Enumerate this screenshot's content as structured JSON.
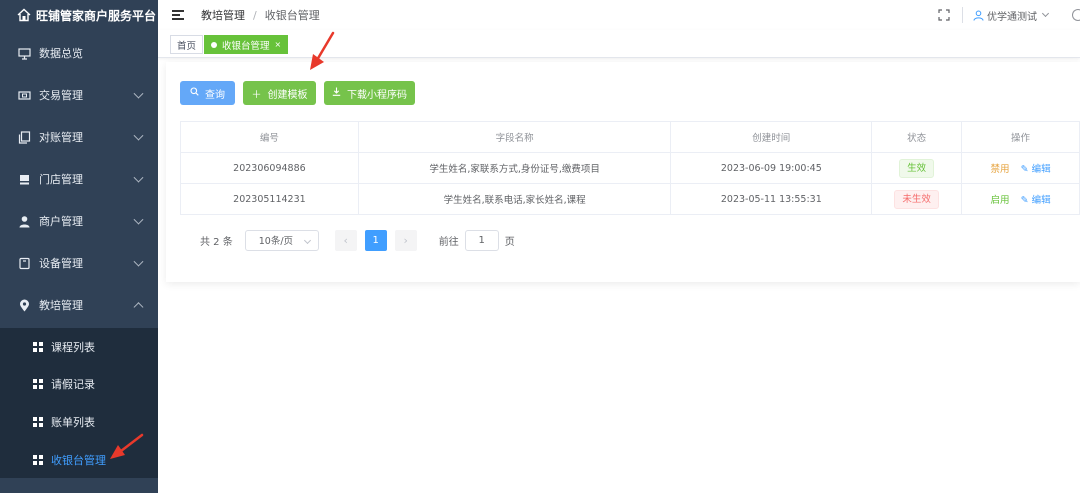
{
  "brand": {
    "title": "旺铺管家商户服务平台"
  },
  "sidebar": {
    "items": [
      {
        "label": "数据总览",
        "icon": "monitor-icon",
        "expandable": false
      },
      {
        "label": "交易管理",
        "icon": "money-icon",
        "expandable": true
      },
      {
        "label": "对账管理",
        "icon": "copy-icon",
        "expandable": true
      },
      {
        "label": "门店管理",
        "icon": "shop-icon",
        "expandable": true
      },
      {
        "label": "商户管理",
        "icon": "user-icon",
        "expandable": true
      },
      {
        "label": "设备管理",
        "icon": "device-icon",
        "expandable": true
      },
      {
        "label": "教培管理",
        "icon": "location-icon",
        "expandable": true,
        "expanded": true
      }
    ],
    "subitems": [
      {
        "label": "课程列表",
        "active": false
      },
      {
        "label": "请假记录",
        "active": false
      },
      {
        "label": "账单列表",
        "active": false
      },
      {
        "label": "收银台管理",
        "active": true
      }
    ]
  },
  "header": {
    "breadcrumb": [
      "教培管理",
      "收银台管理"
    ],
    "user_name": "优学通测试"
  },
  "tags": [
    {
      "label": "首页",
      "active": false
    },
    {
      "label": "收银台管理",
      "active": true,
      "close": "×"
    }
  ],
  "toolbar": {
    "search_label": "查询",
    "create_label": "创建模板",
    "download_label": "下载小程序码"
  },
  "table": {
    "columns": [
      "编号",
      "字段名称",
      "创建时间",
      "状态",
      "操作"
    ],
    "rows": [
      {
        "id": "202306094886",
        "fields": "学生姓名,家联系方式,身份证号,缴费项目",
        "created": "2023-06-09 19:00:45",
        "status": "生效",
        "status_type": "ok",
        "action": "禁用",
        "edit": "编辑"
      },
      {
        "id": "202305114231",
        "fields": "学生姓名,联系电话,家长姓名,课程",
        "created": "2023-05-11 13:55:31",
        "status": "未生效",
        "status_type": "off",
        "action": "启用",
        "edit": "编辑"
      }
    ]
  },
  "pagination": {
    "total_text": "共 2 条",
    "page_size": "10条/页",
    "current_page": "1",
    "goto_prefix": "前往",
    "goto_value": "1",
    "goto_suffix": "页"
  },
  "colors": {
    "sidebar_bg": "#304156",
    "submenu_bg": "#1f2d3d",
    "primary": "#409eff",
    "success": "#67c23a",
    "danger": "#f56c6c",
    "warning": "#e6a23c",
    "annotation": "#e8392b"
  }
}
